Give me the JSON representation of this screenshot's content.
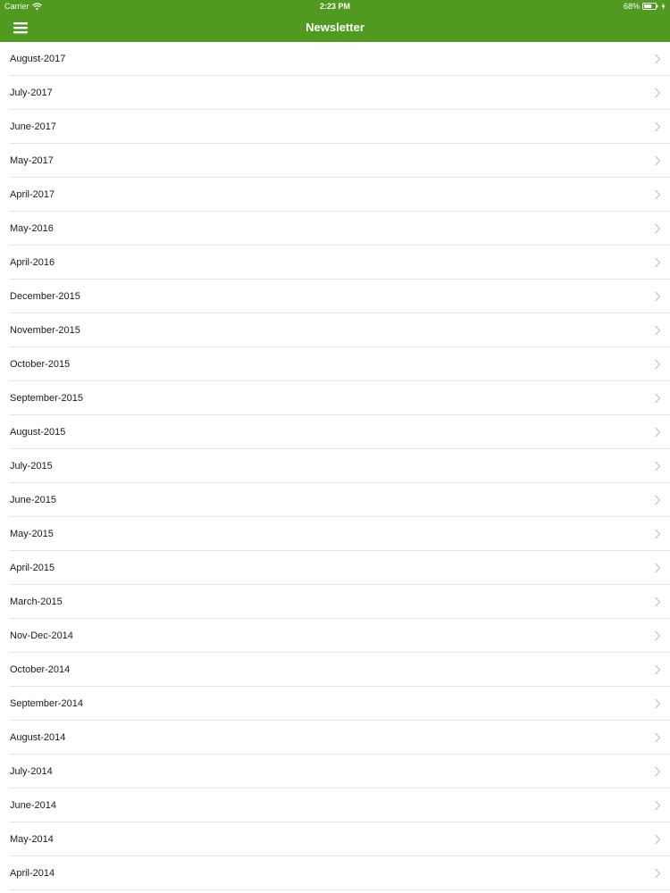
{
  "colors": {
    "header_bg": "#4f9a1f",
    "header_text": "#ffffff",
    "divider": "#e4e4e4",
    "chevron": "#c7c7cc",
    "text": "#1a1a1a"
  },
  "status_bar": {
    "carrier": "Carrier",
    "time": "2:23 PM",
    "battery": "68%",
    "icons": [
      "wifi-icon",
      "battery-icon",
      "charging-icon"
    ]
  },
  "nav": {
    "title": "Newsletter",
    "menu_icon": "hamburger-menu-icon"
  },
  "list": {
    "items": [
      {
        "label": "August-2017"
      },
      {
        "label": "July-2017"
      },
      {
        "label": "June-2017"
      },
      {
        "label": "May-2017"
      },
      {
        "label": "April-2017"
      },
      {
        "label": "May-2016"
      },
      {
        "label": "April-2016"
      },
      {
        "label": "December-2015"
      },
      {
        "label": "November-2015"
      },
      {
        "label": "October-2015"
      },
      {
        "label": "September-2015"
      },
      {
        "label": "August-2015"
      },
      {
        "label": "July-2015"
      },
      {
        "label": "June-2015"
      },
      {
        "label": "May-2015"
      },
      {
        "label": "April-2015"
      },
      {
        "label": "March-2015"
      },
      {
        "label": "Nov-Dec-2014"
      },
      {
        "label": "October-2014"
      },
      {
        "label": "September-2014"
      },
      {
        "label": "August-2014"
      },
      {
        "label": "July-2014"
      },
      {
        "label": "June-2014"
      },
      {
        "label": "May-2014"
      },
      {
        "label": "April-2014"
      }
    ],
    "item_icon": "chevron-right-icon"
  }
}
